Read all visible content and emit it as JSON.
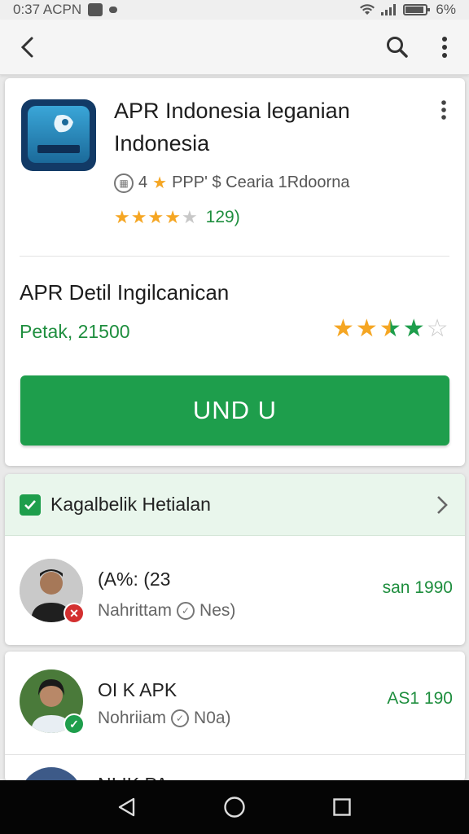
{
  "status_bar": {
    "time": "0:37 ACPN",
    "battery": "6%"
  },
  "app": {
    "title": "APR Indonesia leganian Indonesia",
    "meta_rating": "4",
    "meta_text": "PPP' $ Cearia 1Rdoorna",
    "rating_value": 4,
    "review_count": "129)"
  },
  "detail": {
    "title": "APR Detil Ingilcanican",
    "price": "Petak, 21500",
    "rating_value": 3.5,
    "install_label": "UND U"
  },
  "list": {
    "header_label": "Kagalbelik Hetialan",
    "items": [
      {
        "name": "(A%: (23",
        "sub": "Nahrittam",
        "sub_tail": "Nes)",
        "price": "san 1990",
        "status": "error"
      },
      {
        "name": "OI K APK",
        "sub": "Nohriiam",
        "sub_tail": "N0a)",
        "price": "AS1 190",
        "status": "ok"
      }
    ]
  },
  "partial_row_label": "NI IK PA",
  "colors": {
    "accent_green": "#1e9e4c",
    "price_green": "#1e8e3e",
    "star_gold": "#f5a623",
    "error_red": "#d32f2f"
  }
}
